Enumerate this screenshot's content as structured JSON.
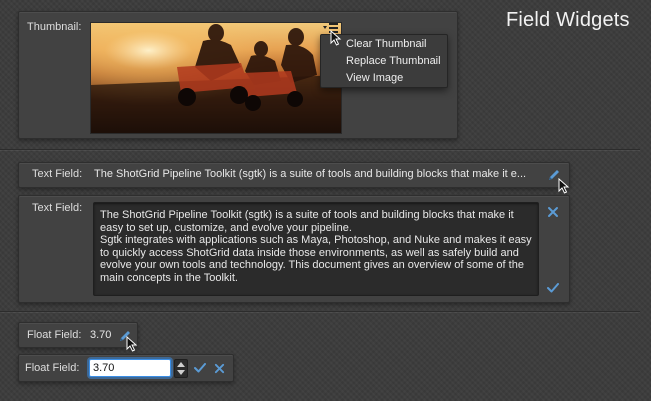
{
  "window": {
    "title": "Field Widgets"
  },
  "colors": {
    "accent": "#5b9bd5",
    "background": "#3b3b3b",
    "panel": "#424242"
  },
  "thumbnail_field": {
    "label": "Thumbnail:",
    "menu_icon": "menu-icon",
    "menu_items": [
      "Clear Thumbnail",
      "Replace Thumbnail",
      "View Image"
    ]
  },
  "text_field_readonly": {
    "label": "Text Field:",
    "value": "The ShotGrid Pipeline Toolkit (sgtk) is a suite of tools and building blocks that make it e...",
    "edit_icon": "pencil-icon"
  },
  "text_field_edit": {
    "label": "Text Field:",
    "lines": [
      "The ShotGrid Pipeline Toolkit (sgtk) is a suite of tools and building blocks that make it",
      "easy to set up, customize, and evolve your pipeline.",
      "Sgtk integrates with applications such as Maya, Photoshop, and Nuke and makes it easy",
      "to quickly access ShotGrid data inside those environments, as well as safely build and",
      "evolve your own tools and technology. This document gives an overview of some of the",
      "main concepts in the Toolkit."
    ],
    "clear_icon": "close-icon",
    "apply_icon": "checkmark-icon"
  },
  "float_field_readonly": {
    "label": "Float Field:",
    "value": "3.70",
    "edit_icon": "pencil-icon"
  },
  "float_field_edit": {
    "label": "Float Field:",
    "value": "3.70",
    "stepper_icon": "stepper-icon",
    "apply_icon": "checkmark-icon",
    "clear_icon": "close-icon"
  }
}
